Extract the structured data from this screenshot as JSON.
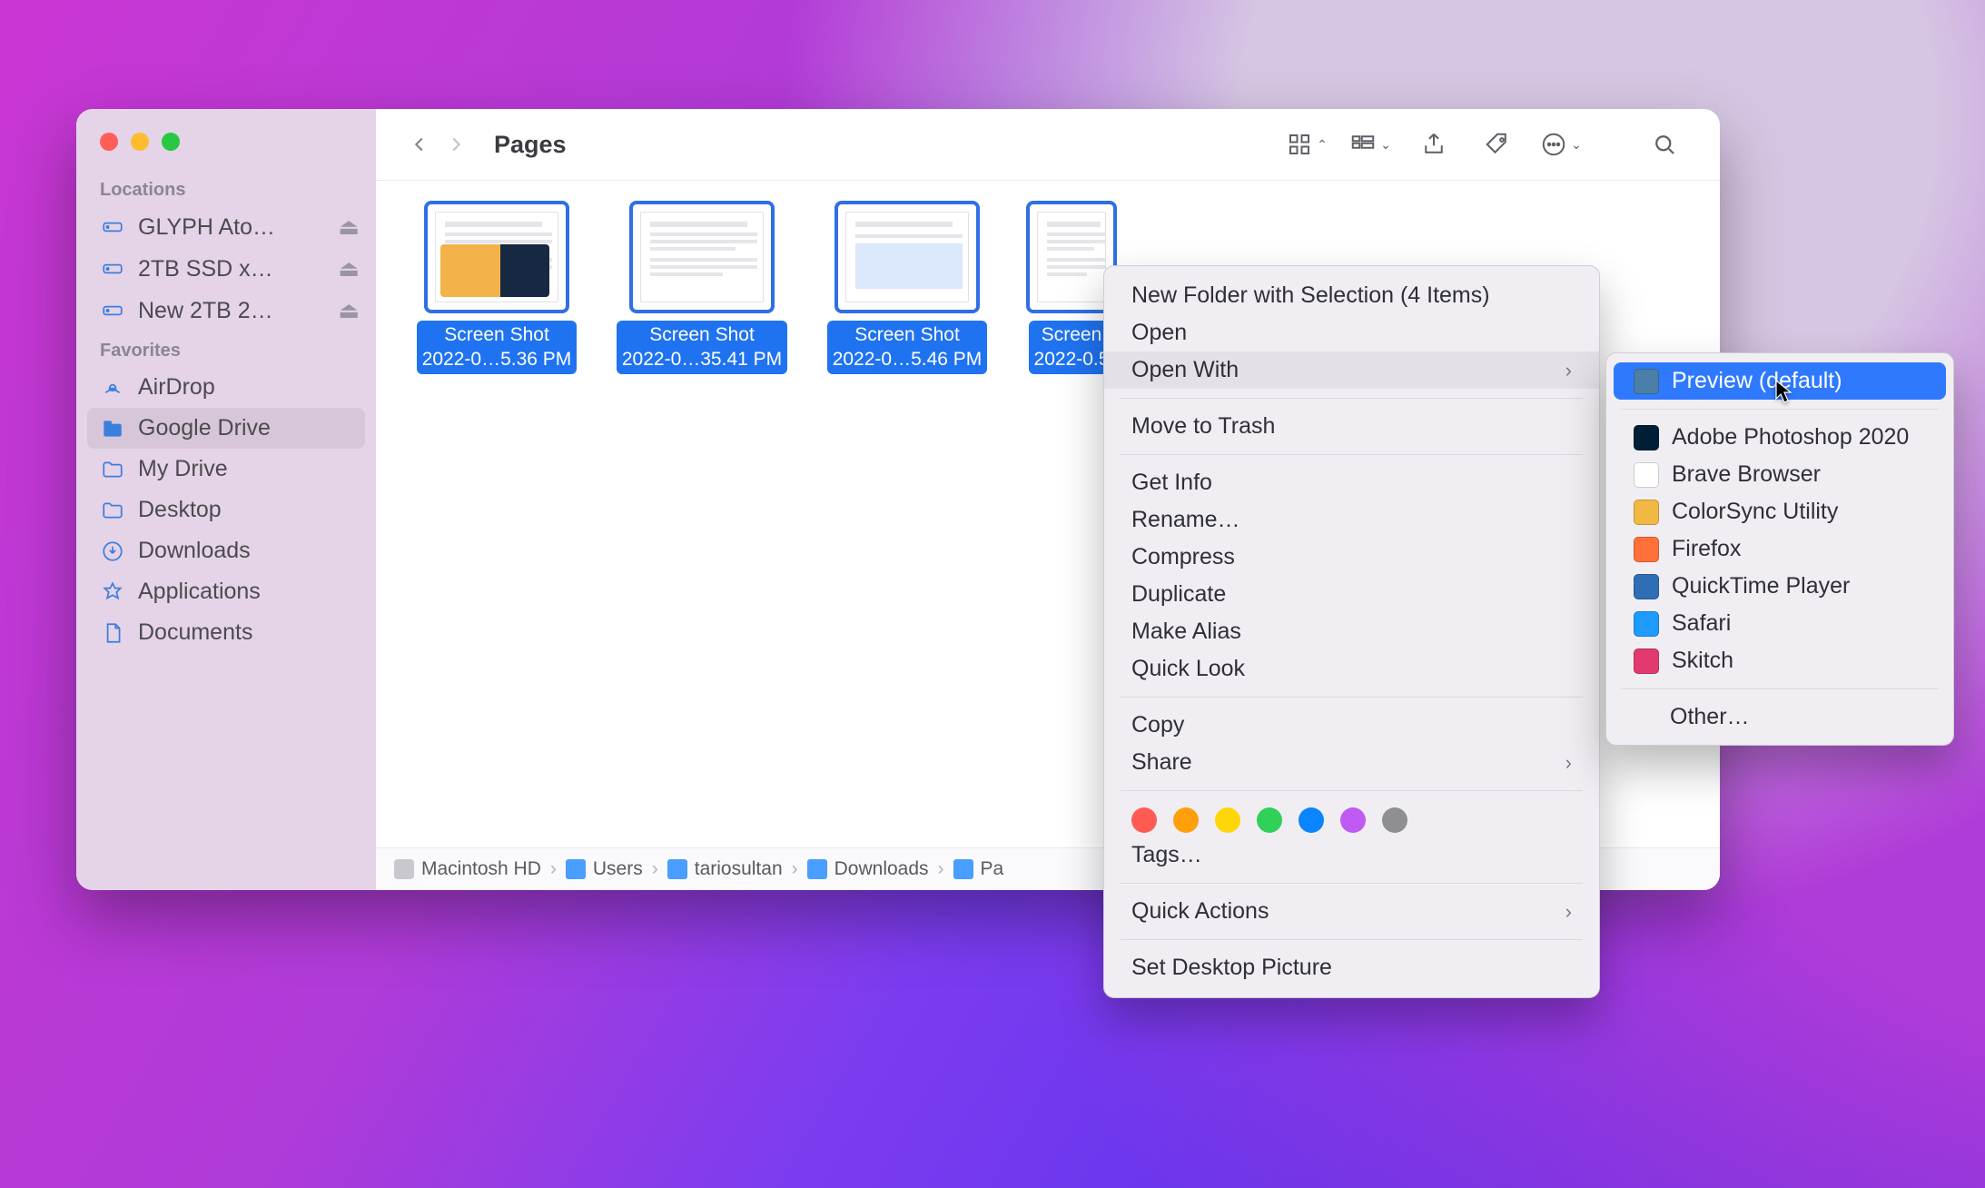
{
  "window": {
    "title": "Pages"
  },
  "sidebar": {
    "sections": [
      {
        "header": "Locations",
        "items": [
          {
            "label": "GLYPH Ato…",
            "icon": "drive",
            "ejectable": true
          },
          {
            "label": "2TB SSD x…",
            "icon": "drive",
            "ejectable": true
          },
          {
            "label": "New 2TB 2…",
            "icon": "drive",
            "ejectable": true
          }
        ]
      },
      {
        "header": "Favorites",
        "items": [
          {
            "label": "AirDrop",
            "icon": "airdrop"
          },
          {
            "label": "Google Drive",
            "icon": "gdrive",
            "selected": true
          },
          {
            "label": "My Drive",
            "icon": "folder"
          },
          {
            "label": "Desktop",
            "icon": "folder"
          },
          {
            "label": "Downloads",
            "icon": "download"
          },
          {
            "label": "Applications",
            "icon": "apps"
          },
          {
            "label": "Documents",
            "icon": "doc"
          }
        ]
      }
    ]
  },
  "files": [
    {
      "name_l1": "Screen Shot",
      "name_l2": "2022-0…5.36 PM"
    },
    {
      "name_l1": "Screen Shot",
      "name_l2": "2022-0…35.41 PM"
    },
    {
      "name_l1": "Screen Shot",
      "name_l2": "2022-0…5.46 PM"
    },
    {
      "name_l1": "Screen",
      "name_l2": "2022-0.5"
    }
  ],
  "pathbar": [
    "Macintosh HD",
    "Users",
    "tariosultan",
    "Downloads",
    "Pa"
  ],
  "context_menu": {
    "new_folder": "New Folder with Selection (4 Items)",
    "open": "Open",
    "open_with": "Open With",
    "trash": "Move to Trash",
    "get_info": "Get Info",
    "rename": "Rename…",
    "compress": "Compress",
    "duplicate": "Duplicate",
    "alias": "Make Alias",
    "quicklook": "Quick Look",
    "copy": "Copy",
    "share": "Share",
    "tags": "Tags…",
    "quick_actions": "Quick Actions",
    "desktop_picture": "Set Desktop Picture",
    "tag_colors": [
      "#ff5b52",
      "#ff9f0a",
      "#ffd60a",
      "#30d158",
      "#0a84ff",
      "#bf5af2",
      "#8e8e93"
    ]
  },
  "open_with_menu": {
    "items": [
      {
        "label": "Preview (default)",
        "color": "#4a7fa8",
        "selected": true
      },
      {
        "label": "Adobe Photoshop 2020",
        "color": "#001e36"
      },
      {
        "label": "Brave Browser",
        "color": "#ffffff"
      },
      {
        "label": "ColorSync Utility",
        "color": "#f2b844"
      },
      {
        "label": "Firefox",
        "color": "#ff7139"
      },
      {
        "label": "QuickTime Player",
        "color": "#2f6eb5"
      },
      {
        "label": "Safari",
        "color": "#1f9bff"
      },
      {
        "label": "Skitch",
        "color": "#e23a6e"
      }
    ],
    "other": "Other…"
  }
}
